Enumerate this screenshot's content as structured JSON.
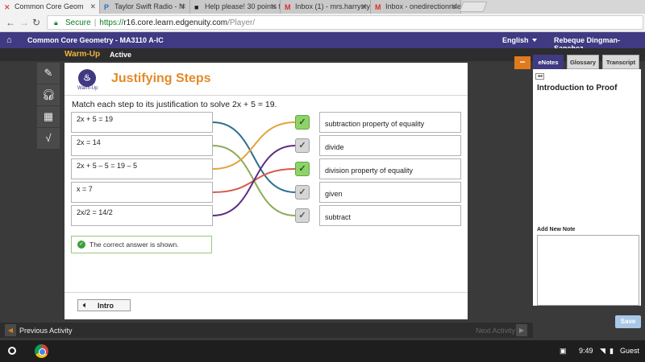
{
  "browser": {
    "tabs": [
      {
        "label": "Common Core Geom",
        "icon": "x-favicon-icon",
        "active": true
      },
      {
        "label": "Taylor Swift Radio - N",
        "icon": "pandora-icon",
        "active": false
      },
      {
        "label": "Help please! 30 points f",
        "icon": "brainly-icon",
        "active": false
      },
      {
        "label": "Inbox (1) - mrs.harrystyle",
        "icon": "gmail-icon",
        "active": false
      },
      {
        "label": "Inbox - onedirectionrulez",
        "icon": "gmail-icon",
        "active": false
      }
    ],
    "secure_label": "Secure",
    "url_scheme": "https://",
    "url_host": "r16.core.learn.edgenuity.com",
    "url_path": "/Player/"
  },
  "app": {
    "course_title": "Common Core Geometry - MA3110 A-IC",
    "language": "English",
    "user_name": "Rebeque Dingman-Sanchez",
    "activity_title": "Warm-Up",
    "activity_status": "Active"
  },
  "lesson": {
    "badge_label": "Warm-Up",
    "title": "Justifying Steps",
    "prompt": "Match each step to its justification to solve 2x + 5 = 19.",
    "steps": [
      "2x + 5 = 19",
      "2x = 14",
      "2x + 5 – 5 = 19 – 5",
      "x = 7",
      "2x/2 = 14/2"
    ],
    "justifications": [
      "subtraction property of equality",
      "divide",
      "division property of equality",
      "given",
      "subtract"
    ],
    "matches": [
      3,
      4,
      0,
      2,
      1
    ],
    "check_states": [
      "correct",
      "neutral",
      "correct",
      "neutral",
      "neutral"
    ],
    "line_colors": [
      "#2b6f8e",
      "#8bab57",
      "#e2a33a",
      "#d75a4c",
      "#5c2d82"
    ],
    "feedback": "The correct answer is shown.",
    "intro_label": "Intro"
  },
  "side_panel": {
    "tabs": [
      "eNotes",
      "Glossary",
      "Transcript"
    ],
    "active_tab": "eNotes",
    "title": "Introduction to Proof",
    "add_note_label": "Add New Note",
    "note_value": "",
    "save_label": "Save"
  },
  "nav": {
    "previous_label": "Previous Activity",
    "next_label": "Next Activity"
  },
  "shelf": {
    "time": "9:49",
    "user": "Guest"
  },
  "colors": {
    "brand": "#3f3a82",
    "accent": "#e38a28"
  }
}
